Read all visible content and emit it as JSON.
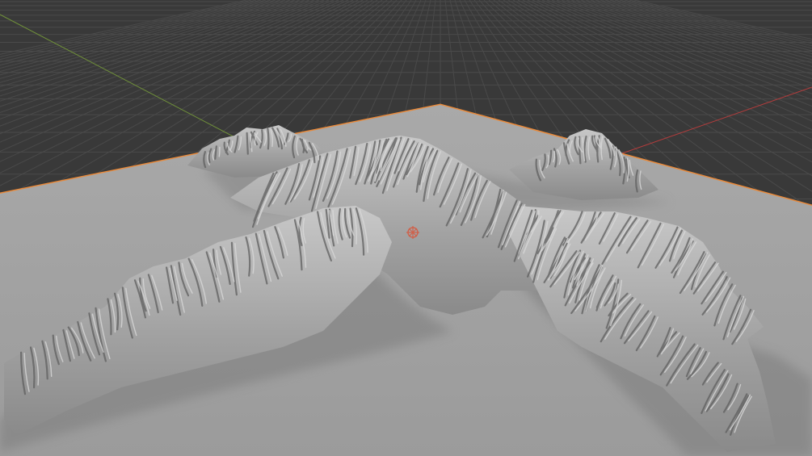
{
  "app": "3D viewport",
  "viewport": {
    "background_color": "#393939",
    "grid_line_color": "#4a4a4a",
    "x_axis_color": "#b43c3c",
    "y_axis_color": "#6f8f3a",
    "selection_outline_color": "#e8893a"
  },
  "scene": {
    "object": "terrain-mesh",
    "object_selected": true,
    "surface_color": "#a3a3a3",
    "shading": "solid"
  },
  "overlays": {
    "origin_marker_icon": "object-origin-icon",
    "origin_marker_color": "#d0604a"
  }
}
